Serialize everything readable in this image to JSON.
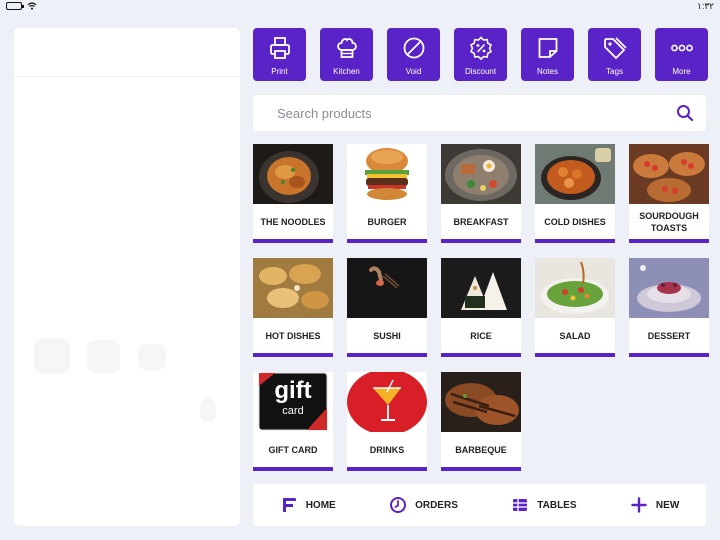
{
  "status_bar": {
    "time": "١:٣٢"
  },
  "toolbar": [
    {
      "label": "Print",
      "icon": "printer-icon"
    },
    {
      "label": "Kitchen",
      "icon": "chef-hat-icon"
    },
    {
      "label": "Void",
      "icon": "void-icon"
    },
    {
      "label": "Discount",
      "icon": "discount-icon"
    },
    {
      "label": "Notes",
      "icon": "note-icon"
    },
    {
      "label": "Tags",
      "icon": "tag-icon"
    },
    {
      "label": "More",
      "icon": "more-icon"
    }
  ],
  "search": {
    "placeholder": "Search products"
  },
  "categories": [
    {
      "name": "THE NOODLES"
    },
    {
      "name": "BURGER"
    },
    {
      "name": "BREAKFAST"
    },
    {
      "name": "COLD DISHES"
    },
    {
      "name": "SOURDOUGH TOASTS"
    },
    {
      "name": "HOT DISHES"
    },
    {
      "name": "SUSHI"
    },
    {
      "name": "RICE"
    },
    {
      "name": "SALAD"
    },
    {
      "name": "DESSERT"
    },
    {
      "name": "GIFT CARD"
    },
    {
      "name": "DRINKS"
    },
    {
      "name": "BARBEQUE"
    }
  ],
  "gift_card_image_text": {
    "line1": "gift",
    "line2": "card"
  },
  "bottom_nav": [
    {
      "label": "HOME",
      "icon": "logo-icon"
    },
    {
      "label": "ORDERS",
      "icon": "clock-icon"
    },
    {
      "label": "TABLES",
      "icon": "tables-icon"
    },
    {
      "label": "NEW",
      "icon": "plus-icon"
    }
  ],
  "colors": {
    "accent": "#5a23c8",
    "background": "#eef0f7"
  }
}
